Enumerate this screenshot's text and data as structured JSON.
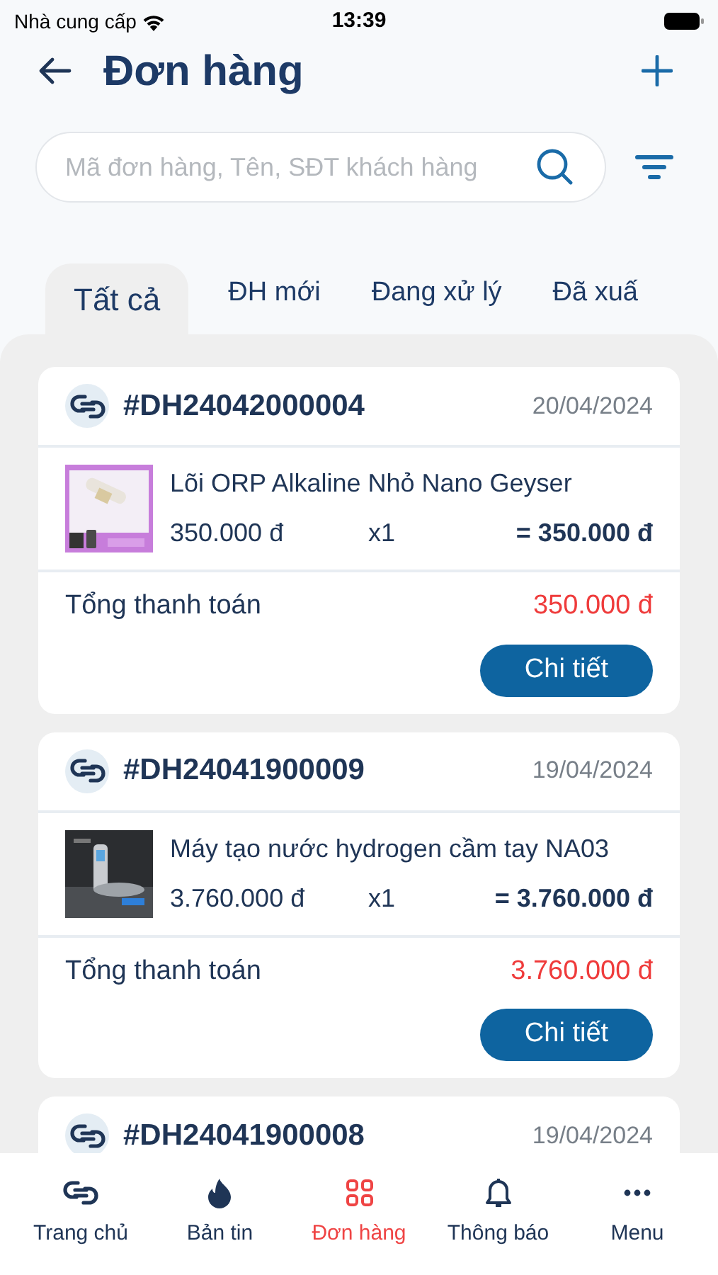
{
  "status_bar": {
    "carrier": "Nhà cung cấp",
    "time": "13:39"
  },
  "header": {
    "title": "Đơn hàng"
  },
  "search": {
    "placeholder": "Mã đơn hàng, Tên, SĐT khách hàng"
  },
  "tabs": [
    {
      "label": "Tất cả",
      "selected": true
    },
    {
      "label": "ĐH mới",
      "selected": false
    },
    {
      "label": "Đang xử lý",
      "selected": false
    },
    {
      "label": "Đã xuấ",
      "selected": false
    }
  ],
  "orders": [
    {
      "code": "#DH24042000004",
      "date": "20/04/2024",
      "items": [
        {
          "name": "Lõi ORP Alkaline Nhỏ Nano Geyser",
          "price": "350.000 đ",
          "qty": "x1",
          "subtotal": "= 350.000 đ",
          "kind": "filter"
        }
      ],
      "total_label": "Tổng thanh toán",
      "total": "350.000 đ",
      "button": "Chi tiết"
    },
    {
      "code": "#DH24041900009",
      "date": "19/04/2024",
      "items": [
        {
          "name": "Máy tạo nước hydrogen cầm tay NA03",
          "price": "3.760.000 đ",
          "qty": "x1",
          "subtotal": "= 3.760.000 đ",
          "kind": "device"
        }
      ],
      "total_label": "Tổng thanh toán",
      "total": "3.760.000 đ",
      "button": "Chi tiết"
    },
    {
      "code": "#DH24041900008",
      "date": "19/04/2024"
    }
  ],
  "bottom_nav": [
    {
      "label": "Trang chủ",
      "kind": "link",
      "selected": false
    },
    {
      "label": "Bản tin",
      "kind": "fire",
      "selected": false
    },
    {
      "label": "Đơn hàng",
      "kind": "grid",
      "selected": true
    },
    {
      "label": "Thông báo",
      "kind": "bell",
      "selected": false
    },
    {
      "label": "Menu",
      "kind": "dots",
      "selected": false
    }
  ]
}
